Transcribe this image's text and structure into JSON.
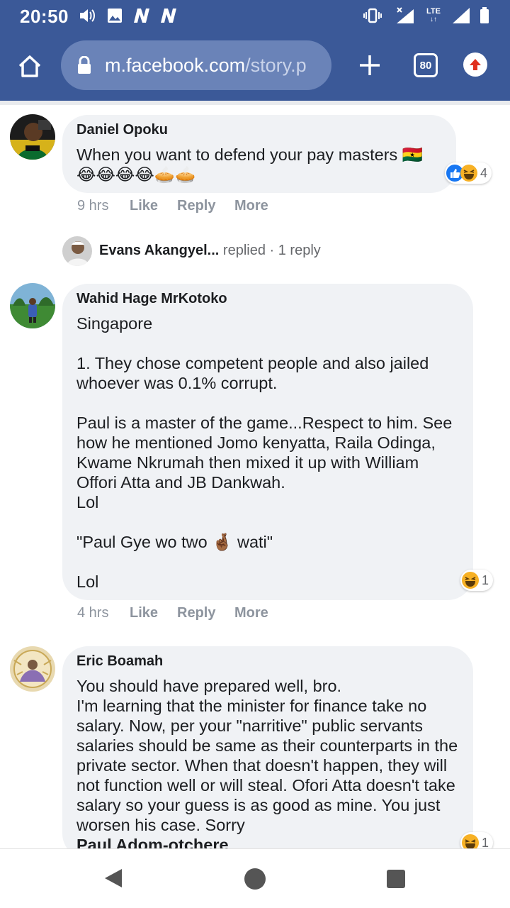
{
  "status_bar": {
    "time": "20:50",
    "left_icons": [
      "volume-icon",
      "image-icon",
      "n-notification-icon",
      "n-notification-icon"
    ],
    "right_icons": [
      "vibrate-icon",
      "no-signal-icon",
      "lte-icon",
      "signal-icon",
      "battery-icon"
    ],
    "lte_label": "LTE"
  },
  "browser": {
    "url_domain": "m.facebook.com",
    "url_path": "/story.p",
    "tab_count": "80",
    "accent": "#3b5998"
  },
  "comments": [
    {
      "author": "Daniel Opoku",
      "text": "When you want to defend your pay masters 🇬🇭\n😂😂😂😂🥧🥧",
      "time": "9 hrs",
      "like": "Like",
      "reply": "Reply",
      "more": "More",
      "reaction_count": "4",
      "reactions": [
        "like-icon",
        "haha-icon"
      ]
    },
    {
      "author": "Wahid Hage MrKotoko",
      "text": "Singapore\n\n1. They chose competent people and also jailed whoever was 0.1% corrupt.\n\nPaul is a master of the game...Respect to him. See how he mentioned Jomo kenyatta, Raila Odinga, Kwame Nkrumah then mixed it up with William Offori Atta and JB Dankwah.\nLol\n\n\"Paul Gye wo two 🤞🏾 wati\"\n\nLol",
      "time": "4 hrs",
      "like": "Like",
      "reply": "Reply",
      "more": "More",
      "reaction_count": "1",
      "reactions": [
        "haha-icon"
      ]
    },
    {
      "author": "Eric Boamah",
      "text": "You should have prepared well, bro.\nI'm learning that the minister for finance take no salary. Now, per your \"narritive\" public servants salaries should be same as their counterparts in the private sector. When that doesn't happen, they will not function well or will steal. Ofori Atta doesn't take salary so your guess is as good as mine. You just worsen his case. Sorry",
      "mention": "Paul Adom-otchere",
      "reaction_count": "1",
      "reactions": [
        "haha-icon"
      ]
    }
  ],
  "reply_thread": {
    "author": "Evans Akangyel...",
    "verb": "replied",
    "separator": "·",
    "count": "1 reply"
  },
  "nav_bar": [
    "back-icon",
    "home-icon",
    "recents-icon"
  ]
}
